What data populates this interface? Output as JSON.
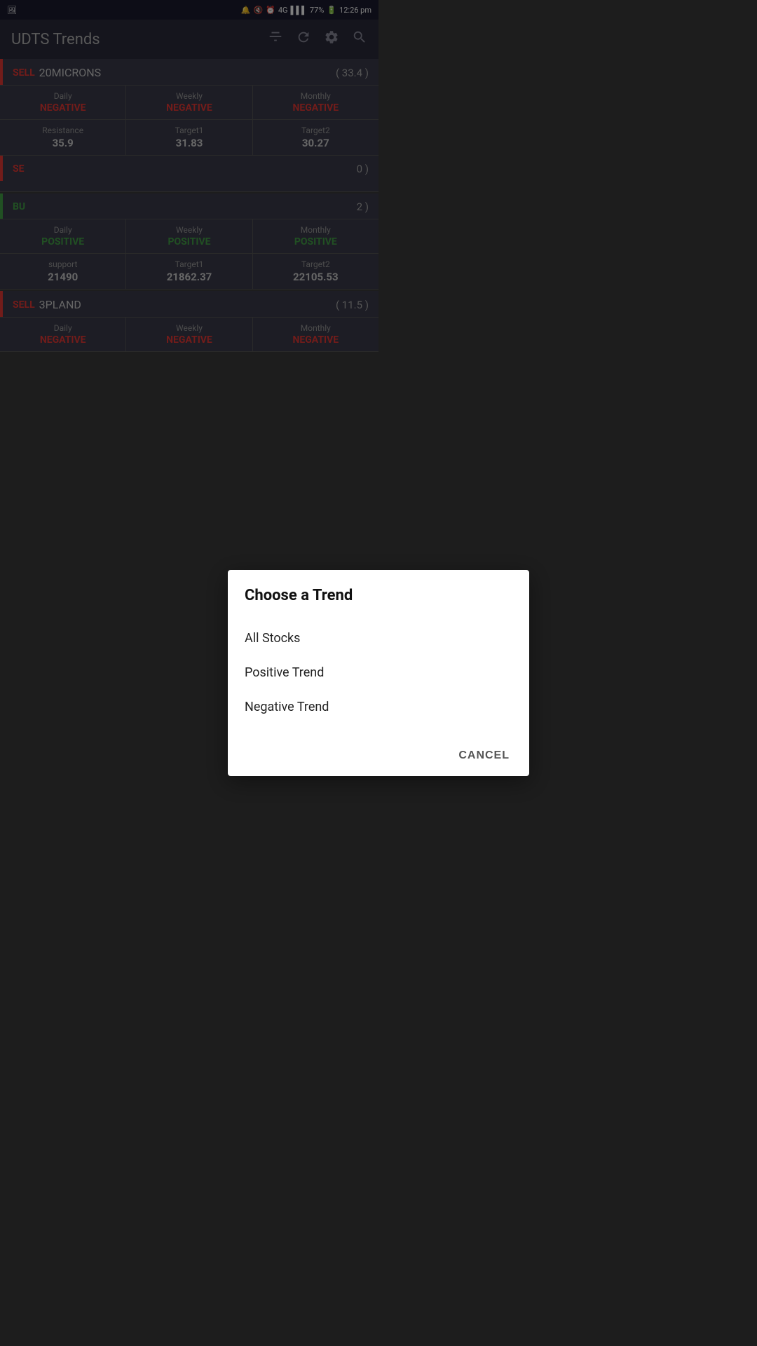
{
  "statusBar": {
    "time": "12:26 pm",
    "battery": "77%",
    "signal": "4G"
  },
  "appBar": {
    "title": "UDTS Trends",
    "filterIcon": "▼",
    "refreshIcon": "↻",
    "settingsIcon": "⚙",
    "searchIcon": "🔍"
  },
  "stockCards": [
    {
      "signal": "SELL",
      "name": "20MICRONS",
      "price": "( 33.4 )",
      "signalType": "sell",
      "trends": [
        {
          "label": "Daily",
          "value": "NEGATIVE",
          "type": "negative"
        },
        {
          "label": "Weekly",
          "value": "NEGATIVE",
          "type": "negative"
        },
        {
          "label": "Monthly",
          "value": "NEGATIVE",
          "type": "negative"
        }
      ],
      "dataRows": [
        {
          "label": "Resistance",
          "value": "35.9"
        },
        {
          "label": "Target1",
          "value": "31.83"
        },
        {
          "label": "Target2",
          "value": "30.27"
        }
      ]
    },
    {
      "signal": "SE",
      "name": "",
      "price": "0 )",
      "signalType": "sell",
      "partial": true
    },
    {
      "signal": "BU",
      "name": "",
      "price": "2 )",
      "signalType": "buy",
      "trends": [
        {
          "label": "Daily",
          "value": "POSITIVE",
          "type": "positive"
        },
        {
          "label": "Weekly",
          "value": "POSITIVE",
          "type": "positive"
        },
        {
          "label": "Monthly",
          "value": "POSITIVE",
          "type": "positive"
        }
      ],
      "dataRows": [
        {
          "label": "support",
          "value": "21490"
        },
        {
          "label": "Target1",
          "value": "21862.37"
        },
        {
          "label": "Target2",
          "value": "22105.53"
        }
      ]
    },
    {
      "signal": "SELL",
      "name": "3PLAND",
      "price": "( 11.5 )",
      "signalType": "sell",
      "partial": true,
      "trends": [
        {
          "label": "Daily",
          "value": "NEGATIVE",
          "type": "negative"
        },
        {
          "label": "Weekly",
          "value": "NEGATIVE",
          "type": "negative"
        },
        {
          "label": "Monthly",
          "value": "NEGATIVE",
          "type": "negative"
        }
      ]
    }
  ],
  "modal": {
    "title": "Choose a Trend",
    "options": [
      {
        "label": "All Stocks"
      },
      {
        "label": "Positive Trend"
      },
      {
        "label": "Negative Trend"
      }
    ],
    "cancelLabel": "CANCEL"
  }
}
